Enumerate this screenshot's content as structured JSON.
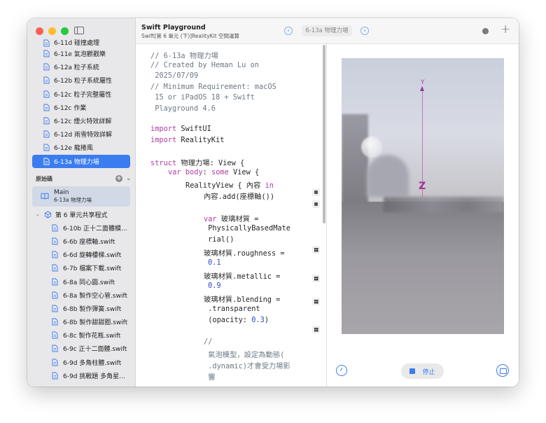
{
  "toolbar": {
    "title": "Swift Playground",
    "subtitle": "Swift[第 6 單元 (下)]RealityKit 空間運算",
    "crumb": "6-13a 物理力場",
    "add_label": "+"
  },
  "sidebar": {
    "items": [
      {
        "label": "6-11d 碰撞處理"
      },
      {
        "label": "6-11e 氣泡觀戳樂"
      },
      {
        "label": "6-12a 粒子系統"
      },
      {
        "label": "6-12b 粒子系統屬性"
      },
      {
        "label": "6-12c 粒子完整屬性"
      },
      {
        "label": "6-12c 作業"
      },
      {
        "label": "6-12c 煙火特效詳解"
      },
      {
        "label": "6-12d 雨雪特效詳解"
      },
      {
        "label": "6-12e 龍捲風"
      },
      {
        "label": "6-13a 物理力場"
      }
    ],
    "source_header": "原始碼",
    "main_file": {
      "name": "Main",
      "subtitle": "6-13a 物理力場"
    },
    "group_label": "第 6 單元共享程式",
    "files": [
      {
        "label": "6-10b 正十二面體模..."
      },
      {
        "label": "6-6b 座標軸.swift"
      },
      {
        "label": "6-6d 旋轉樓梯.swift"
      },
      {
        "label": "6-7b 檔案下載.swift"
      },
      {
        "label": "6-8a 同心圓.swift"
      },
      {
        "label": "6-8a 製作空心管.swift"
      },
      {
        "label": "6-8b 製作彈簧.swift"
      },
      {
        "label": "6-8b 製作甜甜圈.swift"
      },
      {
        "label": "6-8c 製作花瓶.swift"
      },
      {
        "label": "6-9c 正十二面體.swift"
      },
      {
        "label": "6-9d 多角柱體.swift"
      },
      {
        "label": "6-9d 挑戰題 多角星..."
      }
    ]
  },
  "code": {
    "l1": "// 6-13a 物理力場",
    "l2": "// Created by Heman Lu on",
    "l3": " 2025/07/09",
    "l4": "// Minimum Requirement: macOS",
    "l5": " 15 or iPadOS 18 + Swift",
    "l6": " Playground 4.6",
    "import": "import",
    "swiftui": " SwiftUI",
    "realitykit": " RealityKit",
    "struct": "struct",
    "struct_name": " 物理力場: View {",
    "var": "var",
    "body_kw": " body",
    "colon": ": ",
    "some": "some",
    "view_brace": " View {",
    "rv": "RealityView { 內容 ",
    "in": "in",
    "add_axis": "內容.add(座標軸())",
    "var2": "var",
    "mat_decl": " 玻璃材質 =",
    "mat_ctor1": " PhysicallyBasedMate",
    "mat_ctor2": " rial()",
    "rough": "玻璃材質.roughness =",
    "rough_val": "0.1",
    "metal": "玻璃材質.metallic =",
    "metal_val": "0.9",
    "blend": "玻璃材質.blending =",
    "blend2": " .transparent",
    "blend3a": " (opacity: ",
    "blend3_val": "0.3",
    "blend3b": ")",
    "c1": "//",
    "c2": " 氣泡模型，設定為動態(",
    "c3": " .dynamic)才會受力場影",
    "c4": " 響"
  },
  "preview": {
    "axis_y": "Y",
    "axis_z": "Z",
    "stop_label": "停止"
  },
  "colors": {
    "accent": "#3b7cf0",
    "keyword": "#ad3da4",
    "comment": "#6c7986",
    "number": "#2f46d3",
    "axis": "#a0329a"
  }
}
